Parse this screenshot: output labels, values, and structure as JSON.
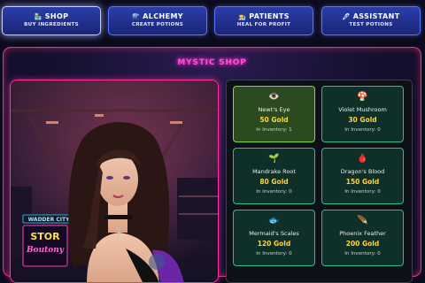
{
  "nav": [
    {
      "icon": "🏪",
      "title": "SHOP",
      "subtitle": "BUY INGREDIENTS",
      "active": true
    },
    {
      "icon": "⚗️",
      "title": "ALCHEMY",
      "subtitle": "CREATE POTIONS",
      "active": false
    },
    {
      "icon": "👨‍🔬",
      "title": "PATIENTS",
      "subtitle": "HEAL FOR PROFIT",
      "active": false
    },
    {
      "icon": "🖊",
      "title": "ASSISTANT",
      "subtitle": "TEST POTIONS",
      "active": false
    }
  ],
  "shop": {
    "title": "MYSTIC SHOP",
    "sign_top": "WADDER CITY",
    "sign_main": "STOR",
    "sign_sub": "Boutony"
  },
  "inventory": [
    {
      "icon": "👁️",
      "name": "Newt's Eye",
      "price": "50 Gold",
      "stock": "In Inventory: 1",
      "selected": true
    },
    {
      "icon": "🍄",
      "name": "Violet Mushroom",
      "price": "30 Gold",
      "stock": "In Inventory: 0",
      "selected": false
    },
    {
      "icon": "🌱",
      "name": "Mandrake Root",
      "price": "80 Gold",
      "stock": "In Inventory: 0",
      "selected": false
    },
    {
      "icon": "🩸",
      "name": "Dragon's Blood",
      "price": "150 Gold",
      "stock": "In Inventory: 0",
      "selected": false
    },
    {
      "icon": "🐟",
      "name": "Mermaid's Scales",
      "price": "120 Gold",
      "stock": "In Inventory: 0",
      "selected": false
    },
    {
      "icon": "🪶",
      "name": "Phoenix Feather",
      "price": "200 Gold",
      "stock": "In Inventory: 0",
      "selected": false
    }
  ],
  "colors": {
    "accent_pink": "#ff2da0",
    "card_border": "#2cbd92",
    "gold": "#ffd43a",
    "selected_card": "#2b4a1f"
  }
}
